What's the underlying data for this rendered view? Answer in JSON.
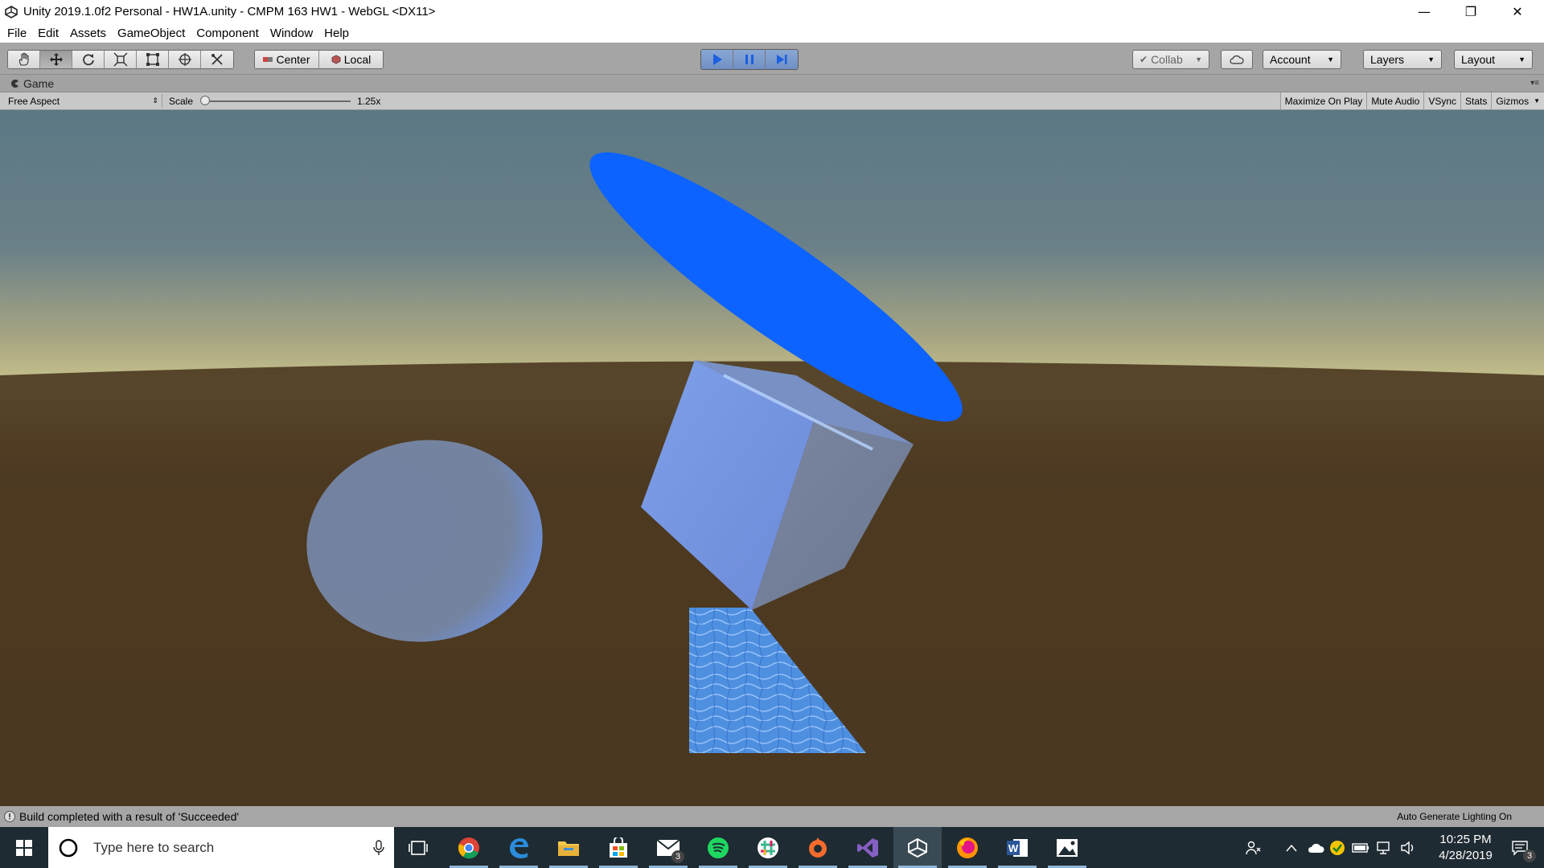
{
  "window": {
    "title": "Unity 2019.1.0f2 Personal - HW1A.unity - CMPM 163 HW1 - WebGL <DX11>",
    "controls": {
      "minimize": "—",
      "restore": "❐",
      "close": "✕"
    }
  },
  "menu": [
    "File",
    "Edit",
    "Assets",
    "GameObject",
    "Component",
    "Window",
    "Help"
  ],
  "toolbar": {
    "tools": [
      "hand-tool-icon",
      "move-tool-icon",
      "rotate-tool-icon",
      "scale-tool-icon",
      "rect-tool-icon",
      "transform-tool-icon",
      "custom-tool-icon"
    ],
    "pivot_label": "Center",
    "space_label": "Local",
    "collab_label": "Collab",
    "account_label": "Account",
    "layers_label": "Layers",
    "layout_label": "Layout",
    "play_state": "playing"
  },
  "game_view": {
    "tab_label": "Game",
    "aspect_label": "Free Aspect",
    "scale_label": "Scale",
    "scale_value": "1.25x",
    "options": [
      "Maximize On Play",
      "Mute Audio",
      "VSync",
      "Stats",
      "Gizmos"
    ]
  },
  "status": {
    "message": "Build completed with a result of 'Succeeded'",
    "right_text": "Auto Generate Lighting On"
  },
  "taskbar": {
    "search_placeholder": "Type here to search",
    "apps": [
      "chrome-icon",
      "edge-icon",
      "file-explorer-icon",
      "store-icon",
      "mail-icon",
      "spotify-icon",
      "slack-icon",
      "origin-icon",
      "visual-studio-icon",
      "unity-icon",
      "firefox-icon",
      "word-icon",
      "photos-icon"
    ],
    "mail_badge": "3",
    "notification_badge": "3",
    "time": "10:25 PM",
    "date": "4/28/2019"
  },
  "colors": {
    "toolbar_bg": "#a5a5a5",
    "play_active": "#7f9fd0",
    "plane_blue": "#0d63ff",
    "sky_top": "#5f7b88",
    "ground": "#4a3720"
  }
}
